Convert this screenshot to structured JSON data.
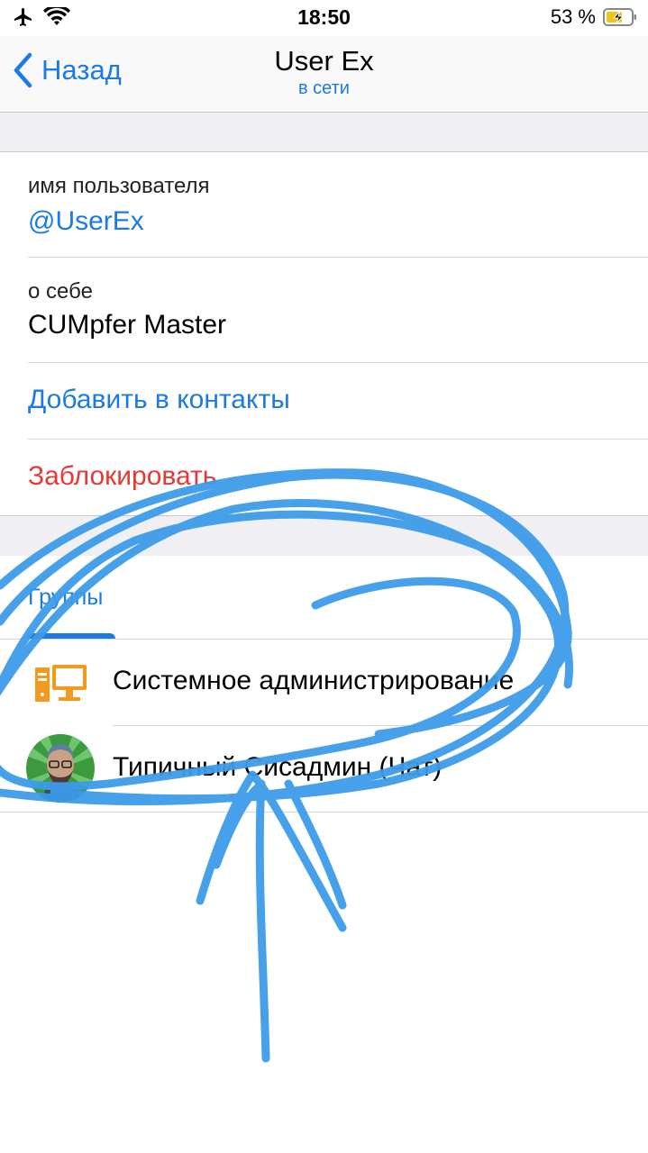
{
  "status_bar": {
    "time": "18:50",
    "battery": "53 %",
    "icons": [
      "airplane-icon",
      "wifi-icon",
      "battery-charging-icon"
    ]
  },
  "nav": {
    "back_label": "Назад",
    "title": "User Ex",
    "subtitle": "в сети"
  },
  "profile": {
    "username_label": "имя пользователя",
    "username": "@UserEx",
    "bio_label": "о себе",
    "bio": "CUMpfer Master",
    "add_contact": "Добавить в контакты",
    "block": "Заблокировать"
  },
  "groups": {
    "tab_label": "Группы",
    "items": [
      {
        "name": "Системное администрирование",
        "icon": "computer-icon"
      },
      {
        "name": "Типичный Сисадмин (Чат)",
        "icon": "avatar"
      }
    ]
  },
  "colors": {
    "accent": "#1b7ae3",
    "danger": "#e53935",
    "group_bg": "#efeff4",
    "annotation": "#3d9be9",
    "icon_orange": "#f39a1e"
  }
}
